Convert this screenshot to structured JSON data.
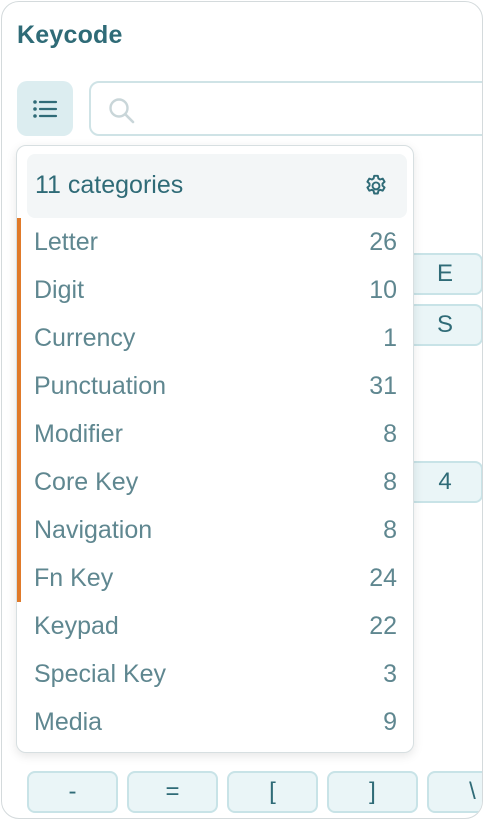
{
  "app": {
    "title": "Keycode"
  },
  "toolbar": {
    "list_icon": "list-icon",
    "search": {
      "placeholder": "",
      "value": "",
      "icon": "search-icon"
    }
  },
  "background_keys": {
    "side": [
      "E",
      "S",
      "4"
    ],
    "bottom_row": [
      "-",
      "=",
      "[",
      "]",
      "\\"
    ]
  },
  "dropdown": {
    "header_label": "11 categories",
    "settings_icon": "gear-icon",
    "accent_color": "#e07a2a",
    "categories": [
      {
        "name": "Letter",
        "count": "26",
        "active": true
      },
      {
        "name": "Digit",
        "count": "10",
        "active": true
      },
      {
        "name": "Currency",
        "count": "1",
        "active": true
      },
      {
        "name": "Punctuation",
        "count": "31",
        "active": true
      },
      {
        "name": "Modifier",
        "count": "8",
        "active": true
      },
      {
        "name": "Core Key",
        "count": "8",
        "active": true
      },
      {
        "name": "Navigation",
        "count": "8",
        "active": true
      },
      {
        "name": "Fn Key",
        "count": "24",
        "active": true
      },
      {
        "name": "Keypad",
        "count": "22",
        "active": false
      },
      {
        "name": "Special Key",
        "count": "3",
        "active": false
      },
      {
        "name": "Media",
        "count": "9",
        "active": false
      }
    ]
  }
}
